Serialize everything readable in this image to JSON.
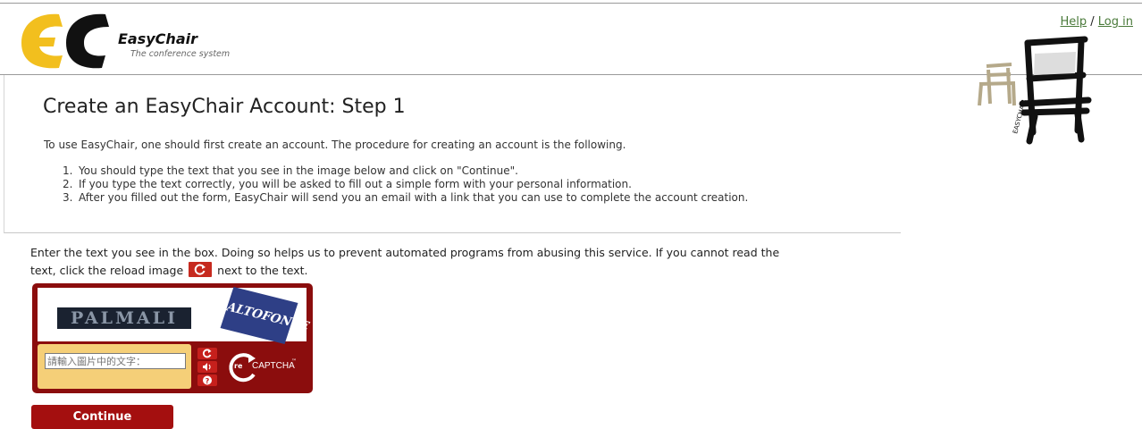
{
  "header": {
    "logo_name": "EasyChair",
    "logo_subtitle": "The conference system",
    "help_link": "Help",
    "separator": "/",
    "login_link": "Log in"
  },
  "main": {
    "title": "Create an EasyChair Account: Step 1",
    "intro": "To use EasyChair, one should first create an account. The procedure for creating an account is the following.",
    "steps": [
      {
        "num": "1.",
        "text": "You should type the text that you see in the image below and click on \"Continue\"."
      },
      {
        "num": "2.",
        "text": "If you type the text correctly, you will be asked to fill out a simple form with your personal information."
      },
      {
        "num": "3.",
        "text": "After you filled out the form, EasyChair will send you an email with a link that you can use to complete the account creation."
      }
    ]
  },
  "captcha": {
    "instructions_before": "Enter the text you see in the box. Doing so helps us to prevent automated programs from abusing this service. If you cannot read the text, click the reload image",
    "instructions_after": "next to the text.",
    "word1": "PALMALI",
    "word2": "ALTOFONTE",
    "input_placeholder": "請輸入圖片中的文字：",
    "input_value": "",
    "brand_prefix": "re",
    "brand": "CAPTCHA",
    "trademark": "™"
  },
  "actions": {
    "continue_label": "Continue"
  },
  "colors": {
    "accent_red": "#a40f0f",
    "link_green": "#4a7a3a",
    "logo_yellow": "#f2bf1e",
    "captcha_yellow": "#f5cf78"
  }
}
